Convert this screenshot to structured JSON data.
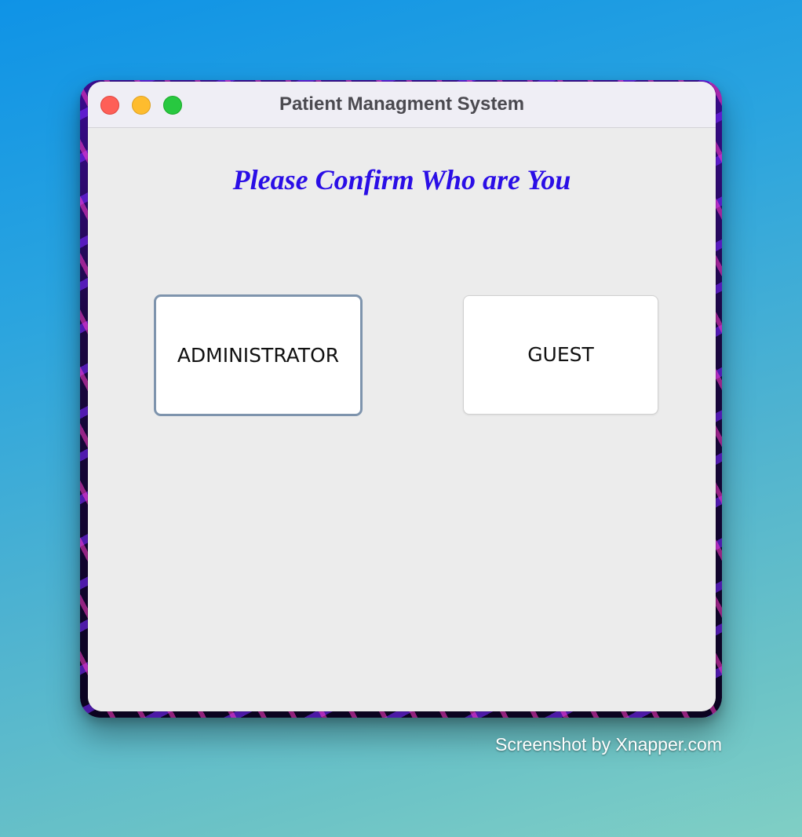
{
  "window": {
    "title": "Patient Managment System",
    "controls": [
      "close",
      "minimize",
      "zoom"
    ]
  },
  "main": {
    "heading": "Please Confirm Who are You",
    "buttons": {
      "administrator": "ADMINISTRATOR",
      "guest": "GUEST"
    }
  },
  "watermark": "Screenshot by Xnapper.com",
  "colors": {
    "heading": "#2a0ee6",
    "close": "#fe5f57",
    "minimize": "#febc2e",
    "zoom": "#28c840",
    "window_background": "#ececec"
  }
}
